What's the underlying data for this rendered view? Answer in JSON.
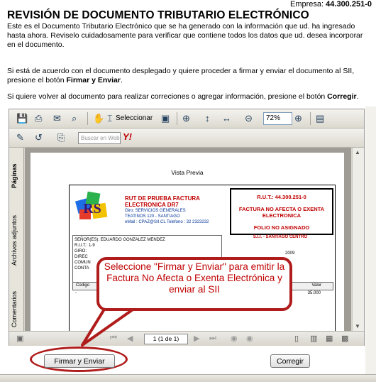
{
  "empresa": {
    "label": "Empresa:",
    "rut": "44.300.251-0"
  },
  "title": "REVISIÓN DE DOCUMENTO TRIBUTARIO ELECTRÓNICO",
  "intro": "Este es el Documento Tributario Electrónico que se ha generado con la información que ud. ha ingresado hasta ahora. Reviselo cuidadosamente para verificar que contiene todos los datos que ud. desea incorporar en el documento.",
  "agree": {
    "pre": "Si está de acuerdo con el documento desplegado y quiere proceder a firmar y enviar el documento al SII, presione el botón ",
    "button": "Firmar y Enviar",
    "post": "."
  },
  "back": {
    "pre": "Si quiere volver al documento para realizar correciones o agregar información, presione el botón ",
    "button": "Corregir",
    "post": "."
  },
  "viewer": {
    "select_label": "Seleccionar",
    "zoom": "72%",
    "search_placeholder": "Buscar en Web",
    "yahoo": "Y!",
    "tabs": [
      "Páginas",
      "Archivos adjuntos",
      "Comentarios"
    ],
    "page_indicator": "1 (1 de 1)"
  },
  "document": {
    "header": "Vista Previa",
    "logo_text": "RS",
    "emisor_name": "RUT DE PRUEBA FACTURA ELECTRONICA DR7",
    "emisor_giro": "Giro: SERVICIOS GENERALES",
    "emisor_dir": "TEATINOS 120 - SANTIAGO",
    "emisor_contact": "eMail : CPAZ@SII.CL Telefono : 32 2323232",
    "rut": "R.U.T.: 44.300.251-0",
    "doc_type": "FACTURA NO AFECTA O EXENTA ELECTRONICA",
    "folio": "FOLIO NO ASIGNADO",
    "sii": "S.I.I. - SANTIAGO CENTRO",
    "client_name": "SEÑOR(ES): EDUARDO GONZALEZ MENDEZ",
    "client_rut": "R.U.T.: 1-9",
    "client_giro": "GIRO:",
    "client_dir": "DIREC",
    "client_comuna": "COMUN",
    "client_contacto": "CONTA",
    "date_year": "2009",
    "col_codigo": "Codigo",
    "col_valor": "Valor",
    "row_dash": "-",
    "row_value": "35.000"
  },
  "callout": "Seleccione \"Firmar y Enviar\" para emitir la Factura No Afecta o Exenta Electrónica y enviar al SII",
  "buttons": {
    "firmar": "Firmar y Enviar",
    "corregir": "Corregir"
  },
  "colors": {
    "accent_red": "#b01c1c",
    "doc_red": "#c00000",
    "doc_blue": "#003399"
  }
}
